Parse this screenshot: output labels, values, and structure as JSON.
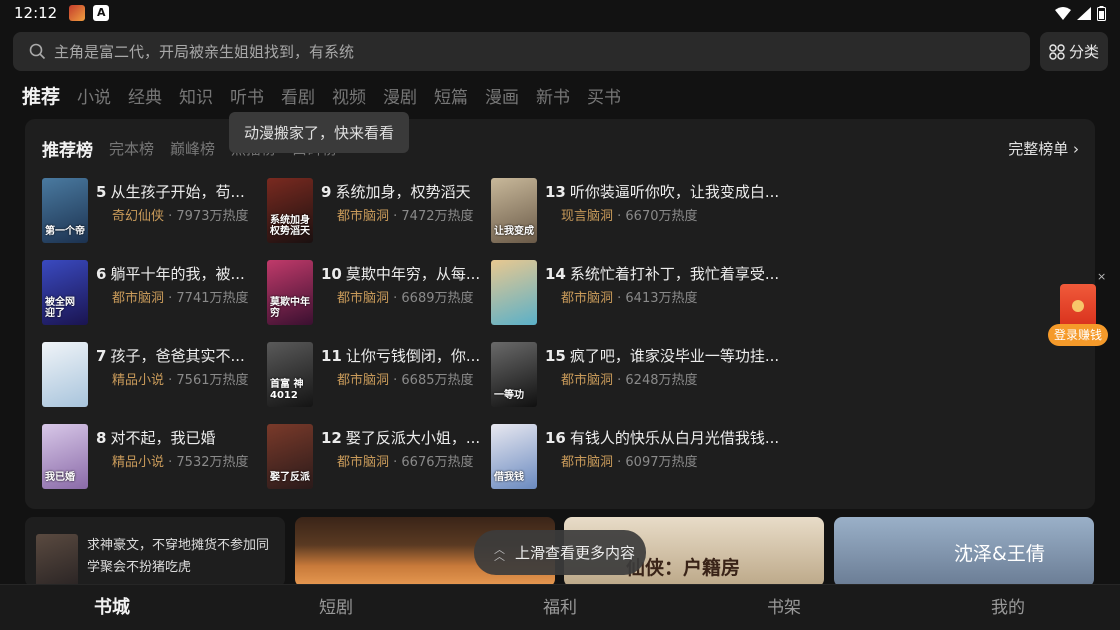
{
  "status_bar": {
    "time": "12:12",
    "app_icon_letter": "A"
  },
  "search": {
    "placeholder": "主角是富二代，开局被亲生姐姐找到，有系统"
  },
  "category_button": {
    "label": "分类"
  },
  "tabs": [
    "推荐",
    "小说",
    "经典",
    "知识",
    "听书",
    "看剧",
    "视频",
    "漫剧",
    "短篇",
    "漫画",
    "新书",
    "买书"
  ],
  "tooltip": "动漫搬家了，快来看看",
  "ranking": {
    "tabs": [
      "推荐榜",
      "完本榜",
      "巅峰榜",
      "热播榜",
      "口碑榜"
    ],
    "full_list_label": "完整榜单 ›",
    "books": [
      {
        "rank": "5",
        "title": "从生孩子开始，苟...",
        "genre": "奇幻仙侠",
        "heat": " · 7973万热度",
        "cover_text": "第一个帝"
      },
      {
        "rank": "6",
        "title": "躺平十年的我，被...",
        "genre": "都市脑洞",
        "heat": " · 7741万热度",
        "cover_text": "被全网 迎了"
      },
      {
        "rank": "7",
        "title": "孩子，爸爸其实不...",
        "genre": "精品小说",
        "heat": " · 7561万热度",
        "cover_text": ""
      },
      {
        "rank": "8",
        "title": "对不起，我已婚",
        "genre": "精品小说",
        "heat": " · 7532万热度",
        "cover_text": "我已婚"
      },
      {
        "rank": "9",
        "title": "系统加身，权势滔天",
        "genre": "都市脑洞",
        "heat": " · 7472万热度",
        "cover_text": "系统加身 权势滔天"
      },
      {
        "rank": "10",
        "title": "莫欺中年穷，从每...",
        "genre": "都市脑洞",
        "heat": " · 6689万热度",
        "cover_text": "莫欺中年穷"
      },
      {
        "rank": "11",
        "title": "让你亏钱倒闭，你...",
        "genre": "都市脑洞",
        "heat": " · 6685万热度",
        "cover_text": "首富 神4012"
      },
      {
        "rank": "12",
        "title": "娶了反派大小姐，...",
        "genre": "都市脑洞",
        "heat": " · 6676万热度",
        "cover_text": "娶了反派"
      },
      {
        "rank": "13",
        "title": "听你装逼听你吹，让我变成白...",
        "genre": "现言脑洞",
        "heat": " · 6670万热度",
        "cover_text": "让我变成"
      },
      {
        "rank": "14",
        "title": "系统忙着打补丁，我忙着享受...",
        "genre": "都市脑洞",
        "heat": " · 6413万热度",
        "cover_text": ""
      },
      {
        "rank": "15",
        "title": "疯了吧，谁家没毕业一等功挂...",
        "genre": "都市脑洞",
        "heat": " · 6248万热度",
        "cover_text": "一等功"
      },
      {
        "rank": "16",
        "title": "有钱人的快乐从白月光借我钱...",
        "genre": "都市脑洞",
        "heat": " · 6097万热度",
        "cover_text": "借我钱"
      }
    ]
  },
  "promo": {
    "text": "求神豪文，不穿地摊货不参加同学聚会不扮猪吃虎"
  },
  "banners": [
    "仙侠：户籍房",
    "沈泽&王倩"
  ],
  "scroll_hint": "上滑查看更多内容",
  "float_ad": {
    "label": "登录赚钱",
    "close": "×"
  },
  "bottom_nav": [
    "书城",
    "短剧",
    "福利",
    "书架",
    "我的"
  ],
  "colors": {
    "background": "#121212",
    "card": "#1e1e1e",
    "genre": "#c89a5a",
    "ad_orange": "#f59a2a"
  }
}
